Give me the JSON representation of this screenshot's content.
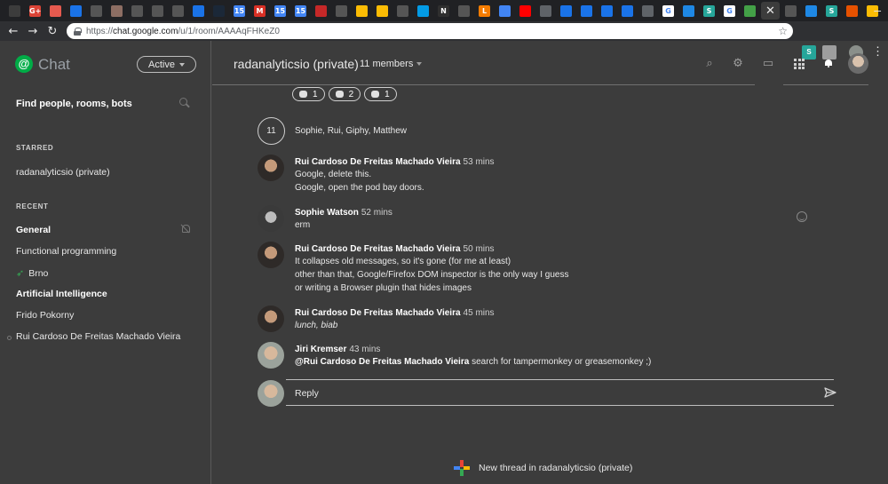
{
  "browser": {
    "tabs": [
      {
        "icon": "blank-tab-icon",
        "color": "#3c3c3c",
        "glyph": ""
      },
      {
        "icon": "google-plus-icon",
        "color": "#db4437",
        "glyph": "G+"
      },
      {
        "icon": "red-app-icon",
        "color": "#e65a4f",
        "glyph": ""
      },
      {
        "icon": "blue-app-icon",
        "color": "#1a73e8",
        "glyph": ""
      },
      {
        "icon": "github-icon",
        "color": "#555555",
        "glyph": ""
      },
      {
        "icon": "jenkins-icon",
        "color": "#8d6e63",
        "glyph": ""
      },
      {
        "icon": "github-icon",
        "color": "#555555",
        "glyph": ""
      },
      {
        "icon": "github-icon",
        "color": "#555555",
        "glyph": ""
      },
      {
        "icon": "github-icon",
        "color": "#555555",
        "glyph": ""
      },
      {
        "icon": "blue-app-icon",
        "color": "#1a73e8",
        "glyph": ""
      },
      {
        "icon": "steam-icon",
        "color": "#1b2838",
        "glyph": ""
      },
      {
        "icon": "calendar-icon",
        "color": "#4285f4",
        "glyph": "15"
      },
      {
        "icon": "gmail-icon",
        "color": "#d93025",
        "glyph": "M"
      },
      {
        "icon": "calendar-icon",
        "color": "#4285f4",
        "glyph": "15"
      },
      {
        "icon": "calendar-icon",
        "color": "#4285f4",
        "glyph": "15"
      },
      {
        "icon": "red-app-icon",
        "color": "#c62828",
        "glyph": ""
      },
      {
        "icon": "github-icon",
        "color": "#555555",
        "glyph": ""
      },
      {
        "icon": "drive-icon",
        "color": "#fbbc04",
        "glyph": ""
      },
      {
        "icon": "drive-icon",
        "color": "#fbbc04",
        "glyph": ""
      },
      {
        "icon": "github-icon",
        "color": "#555555",
        "glyph": ""
      },
      {
        "icon": "cloud-icon",
        "color": "#039be5",
        "glyph": ""
      },
      {
        "icon": "notion-icon",
        "color": "#2f2f2f",
        "glyph": "N"
      },
      {
        "icon": "github-icon",
        "color": "#555555",
        "glyph": ""
      },
      {
        "icon": "l-app-icon",
        "color": "#f57c00",
        "glyph": "L"
      },
      {
        "icon": "translate-icon",
        "color": "#4285f4",
        "glyph": ""
      },
      {
        "icon": "youtube-icon",
        "color": "#ff0000",
        "glyph": ""
      },
      {
        "icon": "page-icon",
        "color": "#5f6368",
        "glyph": ""
      },
      {
        "icon": "openshift-icon",
        "color": "#1a73e8",
        "glyph": ""
      },
      {
        "icon": "openshift-icon",
        "color": "#1a73e8",
        "glyph": ""
      },
      {
        "icon": "openshift-icon",
        "color": "#1a73e8",
        "glyph": ""
      },
      {
        "icon": "openshift-icon",
        "color": "#1a73e8",
        "glyph": ""
      },
      {
        "icon": "page-icon",
        "color": "#5f6368",
        "glyph": ""
      },
      {
        "icon": "google-icon",
        "color": "#ffffff",
        "glyph": "G"
      },
      {
        "icon": "app-icon",
        "color": "#1e88e5",
        "glyph": ""
      },
      {
        "icon": "s-app-icon",
        "color": "#26a69a",
        "glyph": "S"
      },
      {
        "icon": "google-icon",
        "color": "#ffffff",
        "glyph": "G"
      },
      {
        "icon": "chat-app-icon",
        "color": "#43a047",
        "glyph": ""
      }
    ],
    "tabs_after_active": [
      {
        "icon": "github-icon",
        "color": "#555555",
        "glyph": ""
      },
      {
        "icon": "app-icon",
        "color": "#1e88e5",
        "glyph": ""
      },
      {
        "icon": "s-app-icon",
        "color": "#26a69a",
        "glyph": "S"
      },
      {
        "icon": "app-icon",
        "color": "#e65100",
        "glyph": ""
      },
      {
        "icon": "app-icon",
        "color": "#fbbc04",
        "glyph": ""
      }
    ],
    "new_tab_label": "+",
    "url_prefix": "https://",
    "url_host": "chat.google.com",
    "url_path": "/u/1/room/AAAAqFHKeZ0"
  },
  "sidebar": {
    "logo_text": "Chat",
    "status_label": "Active",
    "find_label": "Find people, rooms, bots",
    "starred_header": "STARRED",
    "starred": [
      "radanalyticsio (private)"
    ],
    "recent_header": "RECENT",
    "recent": [
      {
        "label": "General",
        "bold": true
      },
      {
        "label": "Functional programming",
        "bold": false
      },
      {
        "label": "Brno",
        "bold": false
      },
      {
        "label": "Artificial Intelligence",
        "bold": true
      },
      {
        "label": "Frido Pokorny",
        "bold": false
      },
      {
        "label": "Rui Cardoso De Freitas Machado Vieira",
        "bold": false
      }
    ]
  },
  "room": {
    "title": "radanalyticsio (private)",
    "members_label": "11 members"
  },
  "thread": {
    "reactions": [
      {
        "icon": "emoji-reaction-1-icon",
        "count": "1"
      },
      {
        "icon": "emoji-reaction-2-icon",
        "count": "2"
      },
      {
        "icon": "emoji-reaction-3-icon",
        "count": "1"
      }
    ],
    "count": "11",
    "participants": "Sophie, Rui, Giphy, Matthew",
    "messages": [
      {
        "author": "Rui Cardoso De Freitas Machado Vieira",
        "time": "53 mins",
        "lines": [
          "Google, delete this.",
          "Google, open the pod bay doors."
        ]
      },
      {
        "author": "Sophie Watson",
        "time": "52 mins",
        "lines": [
          "erm"
        ]
      },
      {
        "author": "Rui Cardoso De Freitas Machado Vieira",
        "time": "50 mins",
        "lines": [
          "It collapses old messages, so it's gone (for me at least)",
          "other than that, Google/Firefox DOM inspector is the only way I guess",
          "or writing a Browser plugin that hides images"
        ]
      },
      {
        "author": "Rui Cardoso De Freitas Machado Vieira",
        "time": "45 mins",
        "lines": [
          "lunch, biab"
        ]
      },
      {
        "author": "Jiri Kremser",
        "time": "43 mins",
        "mention": "@Rui Cardoso De Freitas Machado Vieira",
        "lines": [
          " search for tampermonkey or greasemonkey ;)"
        ]
      }
    ],
    "reply_placeholder": "Reply"
  },
  "new_thread_label": "New thread in radanalyticsio (private)"
}
